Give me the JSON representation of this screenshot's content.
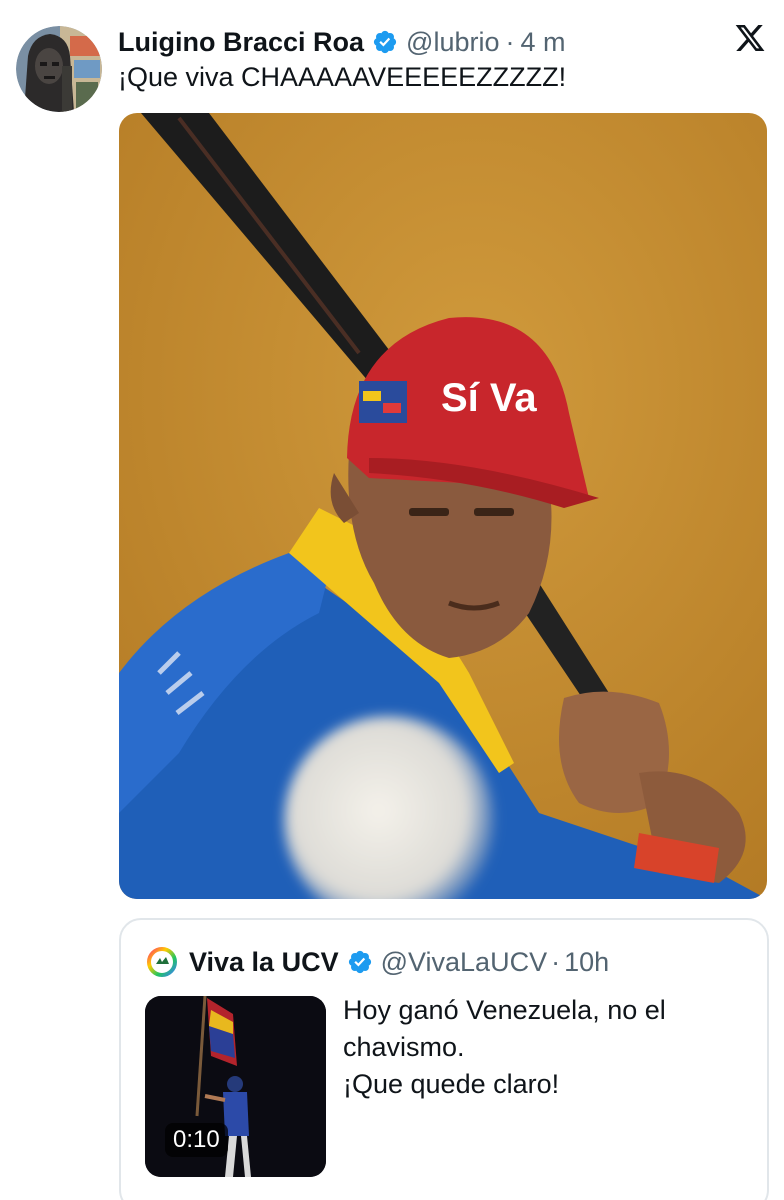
{
  "tweet": {
    "display_name": "Luigino Bracci Roa",
    "handle": "@lubrio",
    "separator": "·",
    "time": "4 m",
    "text": "¡Que viva CHAAAAAVEEEEEZZZZZ!",
    "verified_color": "#1d9bf0",
    "icons": {
      "platform": "x-logo-icon",
      "verified": "verified-badge-icon",
      "avatar": "profile-photo-icon"
    },
    "media": {
      "cap_text": "Sí Va",
      "description_icon": "batter-photo"
    }
  },
  "quote": {
    "display_name": "Viva la UCV",
    "handle": "@VivaLaUCV",
    "separator": "·",
    "time": "10h",
    "text_lines": [
      "Hoy ganó Venezuela, no el",
      "chavismo.",
      "¡Que quede claro!"
    ],
    "video_duration": "0:10",
    "icons": {
      "avatar": "rainbow-ring-logo-icon",
      "verified": "verified-badge-icon",
      "thumbnail": "video-thumbnail-icon"
    }
  },
  "colors": {
    "text_primary": "#0f1419",
    "text_secondary": "#536471",
    "border": "#e1e6ea",
    "accent": "#1d9bf0"
  }
}
